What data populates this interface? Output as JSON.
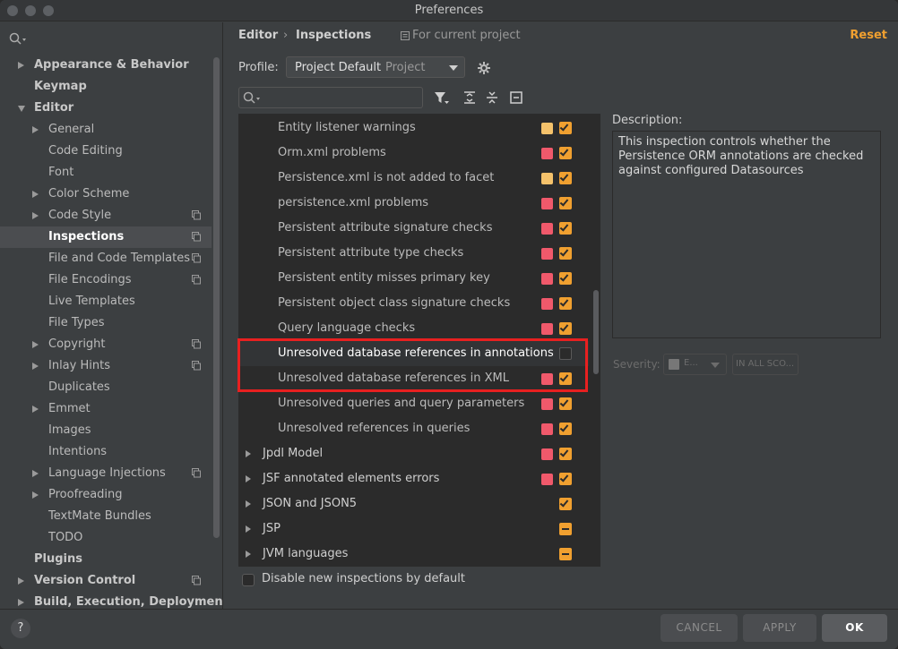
{
  "window": {
    "title": "Preferences"
  },
  "sidebar": {
    "items": [
      {
        "label": "Appearance & Behavior",
        "level": 0,
        "expand": "collapsed",
        "copy": false,
        "bold": true
      },
      {
        "label": "Keymap",
        "level": 0,
        "expand": "none",
        "copy": false,
        "bold": true
      },
      {
        "label": "Editor",
        "level": 0,
        "expand": "expanded",
        "copy": false,
        "bold": true
      },
      {
        "label": "General",
        "level": 1,
        "expand": "collapsed",
        "copy": false
      },
      {
        "label": "Code Editing",
        "level": 1,
        "expand": "none",
        "copy": false
      },
      {
        "label": "Font",
        "level": 1,
        "expand": "none",
        "copy": false
      },
      {
        "label": "Color Scheme",
        "level": 1,
        "expand": "collapsed",
        "copy": false
      },
      {
        "label": "Code Style",
        "level": 1,
        "expand": "collapsed",
        "copy": true
      },
      {
        "label": "Inspections",
        "level": 1,
        "expand": "none",
        "copy": true,
        "selected": true
      },
      {
        "label": "File and Code Templates",
        "level": 1,
        "expand": "none",
        "copy": true
      },
      {
        "label": "File Encodings",
        "level": 1,
        "expand": "none",
        "copy": true
      },
      {
        "label": "Live Templates",
        "level": 1,
        "expand": "none",
        "copy": false
      },
      {
        "label": "File Types",
        "level": 1,
        "expand": "none",
        "copy": false
      },
      {
        "label": "Copyright",
        "level": 1,
        "expand": "collapsed",
        "copy": true
      },
      {
        "label": "Inlay Hints",
        "level": 1,
        "expand": "collapsed",
        "copy": true
      },
      {
        "label": "Duplicates",
        "level": 1,
        "expand": "none",
        "copy": false
      },
      {
        "label": "Emmet",
        "level": 1,
        "expand": "collapsed",
        "copy": false
      },
      {
        "label": "Images",
        "level": 1,
        "expand": "none",
        "copy": false
      },
      {
        "label": "Intentions",
        "level": 1,
        "expand": "none",
        "copy": false
      },
      {
        "label": "Language Injections",
        "level": 1,
        "expand": "collapsed",
        "copy": true
      },
      {
        "label": "Proofreading",
        "level": 1,
        "expand": "collapsed",
        "copy": false
      },
      {
        "label": "TextMate Bundles",
        "level": 1,
        "expand": "none",
        "copy": false
      },
      {
        "label": "TODO",
        "level": 1,
        "expand": "none",
        "copy": false
      },
      {
        "label": "Plugins",
        "level": 0,
        "expand": "none",
        "copy": false,
        "bold": true
      },
      {
        "label": "Version Control",
        "level": 0,
        "expand": "collapsed",
        "copy": true,
        "bold": true
      },
      {
        "label": "Build, Execution, Deployment",
        "level": 0,
        "expand": "collapsed",
        "copy": false,
        "bold": true
      }
    ]
  },
  "header": {
    "breadcrumb_1": "Editor",
    "breadcrumb_sep": "›",
    "breadcrumb_2": "Inspections",
    "scope_note": "For current project",
    "reset_label": "Reset"
  },
  "profile": {
    "label": "Profile:",
    "value": "Project Default",
    "sub": "Project"
  },
  "inspections": [
    {
      "label": "Entity listener warnings",
      "severity_color": "#f5c26b",
      "checked": true,
      "group": false
    },
    {
      "label": "Orm.xml problems",
      "severity_color": "#f0596b",
      "checked": true,
      "group": false
    },
    {
      "label": "Persistence.xml is not added to facet",
      "severity_color": "#f5c26b",
      "checked": true,
      "group": false
    },
    {
      "label": "persistence.xml problems",
      "severity_color": "#f0596b",
      "checked": true,
      "group": false
    },
    {
      "label": "Persistent attribute signature checks",
      "severity_color": "#f0596b",
      "checked": true,
      "group": false
    },
    {
      "label": "Persistent attribute type checks",
      "severity_color": "#f0596b",
      "checked": true,
      "group": false
    },
    {
      "label": "Persistent entity misses primary key",
      "severity_color": "#f0596b",
      "checked": true,
      "group": false
    },
    {
      "label": "Persistent object class signature checks",
      "severity_color": "#f0596b",
      "checked": true,
      "group": false
    },
    {
      "label": "Query language checks",
      "severity_color": "#f0596b",
      "checked": true,
      "group": false
    },
    {
      "label": "Unresolved database references in annotations",
      "severity_color": "",
      "checked": false,
      "group": false,
      "highlighted": true
    },
    {
      "label": "Unresolved database references in XML",
      "severity_color": "#f0596b",
      "checked": true,
      "group": false
    },
    {
      "label": "Unresolved queries and query parameters",
      "severity_color": "#f0596b",
      "checked": true,
      "group": false
    },
    {
      "label": "Unresolved references in queries",
      "severity_color": "#f0596b",
      "checked": true,
      "group": false
    },
    {
      "label": "Jpdl Model",
      "severity_color": "#f0596b",
      "checked": true,
      "group": true
    },
    {
      "label": "JSF annotated elements errors",
      "severity_color": "#f0596b",
      "checked": true,
      "group": true
    },
    {
      "label": "JSON and JSON5",
      "severity_color": "",
      "checked": true,
      "group": true
    },
    {
      "label": "JSP",
      "severity_color": "",
      "checked": "partial",
      "group": true
    },
    {
      "label": "JVM languages",
      "severity_color": "",
      "checked": "partial",
      "group": true
    }
  ],
  "description": {
    "label": "Description:",
    "text": "This inspection controls whether the Persistence ORM annotations are checked against configured Datasources"
  },
  "severity": {
    "label": "Severity:",
    "value": "E...",
    "scope": "IN ALL SCO..."
  },
  "disable_new": {
    "label": "Disable new inspections by default"
  },
  "footer": {
    "help": "?",
    "cancel": "CANCEL",
    "apply": "APPLY",
    "ok": "OK"
  }
}
